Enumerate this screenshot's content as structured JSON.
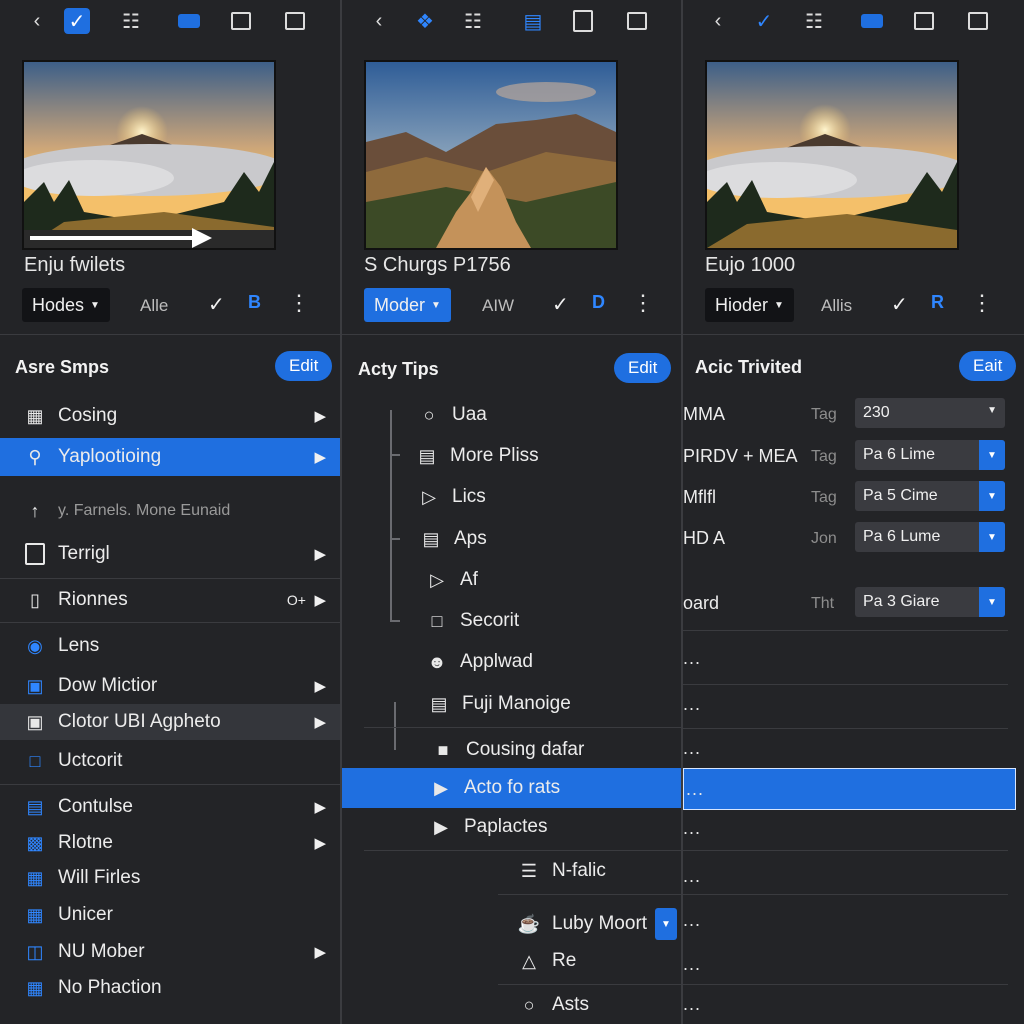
{
  "colors": {
    "accent": "#1f6fe0",
    "panel": "#232427",
    "divider": "#3a3b3f"
  },
  "panel1": {
    "caption": "Enju fwilets",
    "dropdown": "Hodes",
    "ctl_text": "Alle",
    "ctl_b": "B",
    "header": "Asre Smps",
    "edit": "Edit",
    "items": [
      {
        "label": "Cosing",
        "icon": "briefcase-icon"
      },
      {
        "label": "Yaplootioing",
        "icon": "pin-icon"
      },
      {
        "label": "y. Farnels. Mone Eunaid",
        "icon": "up-arrow-icon"
      },
      {
        "label": "Terrigl",
        "icon": "tablet-icon"
      },
      {
        "label": "Rionnes",
        "icon": "phone-icon",
        "extra": "O+"
      },
      {
        "label": "Lens",
        "icon": "lens-icon"
      },
      {
        "label": "Dow Mictior",
        "icon": "monitor-icon"
      },
      {
        "label": "Clotor UBI Agpheto",
        "icon": "camera-icon"
      },
      {
        "label": "Uctcorit",
        "icon": "frame-icon"
      },
      {
        "label": "Contulse",
        "icon": "folder-icon"
      },
      {
        "label": "Rlotne",
        "icon": "chart-icon"
      },
      {
        "label": "Will Firles",
        "icon": "printer-icon"
      },
      {
        "label": "Unicer",
        "icon": "grid-icon"
      },
      {
        "label": "NU Mober",
        "icon": "globe-icon"
      },
      {
        "label": "No Phaction",
        "icon": "select-icon"
      }
    ]
  },
  "panel2": {
    "caption": "S Churgs P1756",
    "dropdown": "Moder",
    "ctl_text": "AIW",
    "ctl_b": "D",
    "header": "Acty Tips",
    "edit": "Edit",
    "items": [
      {
        "label": "Uaa",
        "icon": "circle-icon"
      },
      {
        "label": "More Pliss",
        "icon": "window-icon"
      },
      {
        "label": "Lics",
        "icon": "play-icon"
      },
      {
        "label": "Aps",
        "icon": "folder-icon"
      },
      {
        "label": "Af",
        "icon": "play-icon"
      },
      {
        "label": "Secorit",
        "icon": "square-icon"
      },
      {
        "label": "Applwad",
        "icon": "user-icon"
      },
      {
        "label": "Fuji Manoige",
        "icon": "window-icon"
      },
      {
        "label": "Cousing dafar",
        "icon": "folder-solid-icon"
      },
      {
        "label": "Acto fo rats",
        "icon": "caret-icon"
      },
      {
        "label": "Paplactes",
        "icon": "caret-icon"
      },
      {
        "label": "N-falic",
        "icon": "list-icon"
      },
      {
        "label": "Luby Moort",
        "icon": "cup-icon"
      },
      {
        "label": "Re",
        "icon": "triangle-icon"
      },
      {
        "label": "Asts",
        "icon": "circle-icon"
      }
    ]
  },
  "panel3": {
    "caption": "Eujo 1000",
    "dropdown": "Hioder",
    "ctl_text": "Allis",
    "ctl_b": "R",
    "header": "Acic Trivited",
    "edit": "Eait",
    "rows": [
      {
        "name": "MMA",
        "tag": "Tag",
        "value": "230"
      },
      {
        "name": "PIRDV + MEA",
        "tag": "Tag",
        "value": "Pa 6 Lime"
      },
      {
        "name": "Mflfl",
        "tag": "Tag",
        "value": "Pa 5 Cime"
      },
      {
        "name": "HD A",
        "tag": "Jon",
        "value": "Pa 6 Lume"
      },
      {
        "name": "oard",
        "tag": "Tht",
        "value": "Pa 3 Giare"
      }
    ],
    "ellipsis": "..."
  }
}
